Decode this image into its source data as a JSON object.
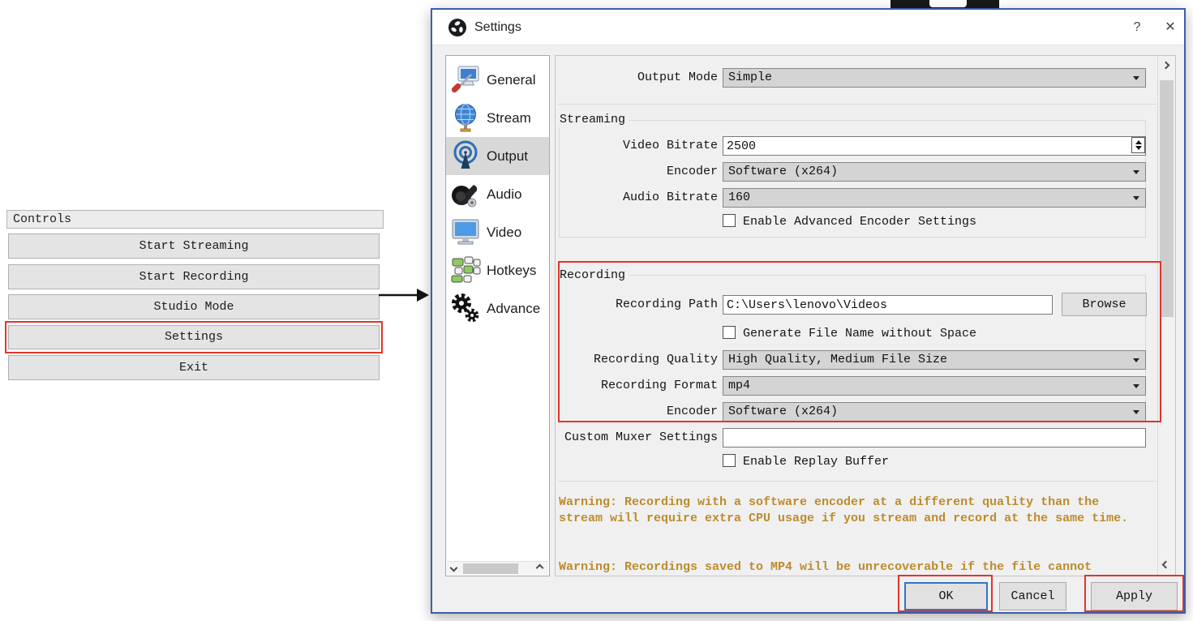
{
  "colors": {
    "annotation_red": "#e0352b",
    "warning_text": "#bd8b2b",
    "dialog_border": "#3a5fa8",
    "selected_item_bg": "#d8d8d8"
  },
  "controls": {
    "header": "Controls",
    "buttons": [
      "Start Streaming",
      "Start Recording",
      "Studio Mode",
      "Settings",
      "Exit"
    ]
  },
  "settings": {
    "title": "Settings",
    "help": "?",
    "close": "✕",
    "sidebar": [
      {
        "label": "General",
        "icon": "general-icon"
      },
      {
        "label": "Stream",
        "icon": "stream-icon"
      },
      {
        "label": "Output",
        "icon": "output-icon",
        "selected": true
      },
      {
        "label": "Audio",
        "icon": "audio-icon"
      },
      {
        "label": "Video",
        "icon": "video-icon"
      },
      {
        "label": "Hotkeys",
        "icon": "hotkeys-icon"
      },
      {
        "label": "Advance",
        "icon": "advanced-icon"
      }
    ],
    "output_mode": {
      "label": "Output Mode",
      "value": "Simple"
    },
    "streaming": {
      "group": "Streaming",
      "video_bitrate": {
        "label": "Video Bitrate",
        "value": "2500"
      },
      "encoder": {
        "label": "Encoder",
        "value": "Software (x264)"
      },
      "audio_bitrate": {
        "label": "Audio Bitrate",
        "value": "160"
      },
      "enable_advanced": "Enable Advanced Encoder Settings"
    },
    "recording": {
      "group": "Recording",
      "path": {
        "label": "Recording Path",
        "value": "C:\\Users\\lenovo\\Videos"
      },
      "browse": "Browse",
      "generate_no_space": "Generate File Name without Space",
      "quality": {
        "label": "Recording Quality",
        "value": "High Quality, Medium File Size"
      },
      "format": {
        "label": "Recording Format",
        "value": "mp4"
      },
      "encoder": {
        "label": "Encoder",
        "value": "Software (x264)"
      }
    },
    "muxer": {
      "label": "Custom Muxer Settings",
      "value": ""
    },
    "enable_replay": "Enable Replay Buffer",
    "warnings": [
      "Warning: Recording with a software encoder at a different quality than the stream will require extra CPU usage if you stream and record at the same time.",
      "Warning: Recordings saved to MP4 will be unrecoverable if the file cannot"
    ],
    "footer": {
      "ok": "OK",
      "cancel": "Cancel",
      "apply": "Apply"
    }
  }
}
